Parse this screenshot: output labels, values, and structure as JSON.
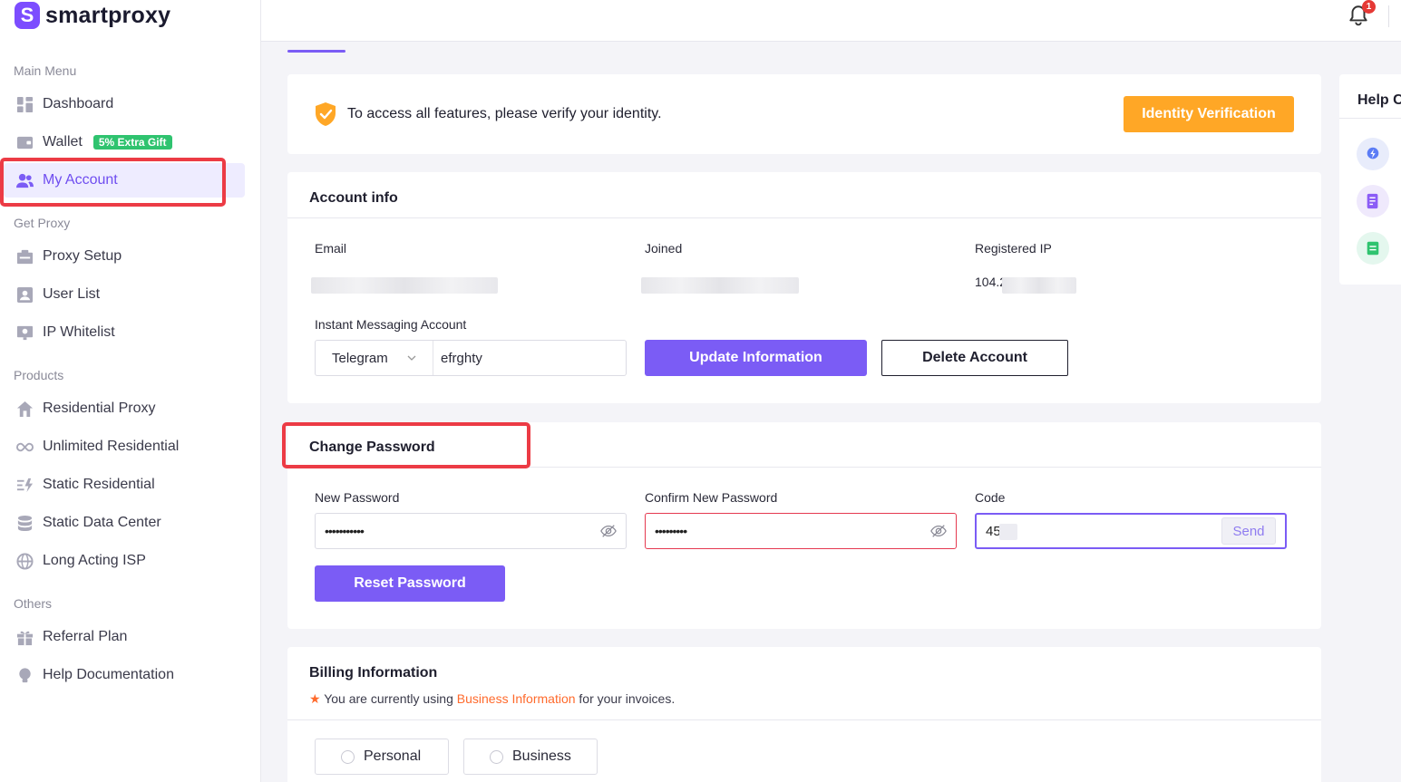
{
  "brand": {
    "name": "smartproxy"
  },
  "sidebar": {
    "sections": {
      "main": "Main Menu",
      "get_proxy": "Get Proxy",
      "products": "Products",
      "others": "Others"
    },
    "items": {
      "dashboard": "Dashboard",
      "wallet": "Wallet",
      "wallet_badge": "5% Extra Gift",
      "my_account": "My Account",
      "proxy_setup": "Proxy Setup",
      "user_list": "User List",
      "ip_whitelist": "IP Whitelist",
      "residential_proxy": "Residential Proxy",
      "unlimited_residential": "Unlimited Residential",
      "static_residential": "Static Residential",
      "static_data_center": "Static Data Center",
      "long_acting_isp": "Long Acting ISP",
      "referral_plan": "Referral Plan",
      "help_documentation": "Help Documentation"
    },
    "active": "my_account"
  },
  "topbar": {
    "notification_count": "1"
  },
  "verify": {
    "message": "To access all features, please verify your identity.",
    "button": "Identity Verification"
  },
  "account_info": {
    "title": "Account info",
    "email_label": "Email",
    "joined_label": "Joined",
    "registered_ip_label": "Registered IP",
    "registered_ip_value": "104.2‹",
    "im_label": "Instant Messaging Account",
    "im_type": "Telegram",
    "im_value": "efrghty",
    "update_button": "Update Information",
    "delete_button": "Delete Account"
  },
  "change_password": {
    "title": "Change Password",
    "new_label": "New Password",
    "new_value": "•••••••••••",
    "confirm_label": "Confirm New Password",
    "confirm_value": "•••••••••",
    "code_label": "Code",
    "code_value": "45",
    "send_button": "Send",
    "reset_button": "Reset Password"
  },
  "billing": {
    "title": "Billing Information",
    "note_prefix": "You are currently using",
    "note_link": "Business Information",
    "note_suffix": "for your invoices.",
    "options": [
      "Personal",
      "Business"
    ]
  },
  "help": {
    "title": "Help Center"
  },
  "colors": {
    "accent": "#7b5cf5",
    "orange": "#ffa726",
    "highlight": "#ec3b45",
    "success": "#2fc36f"
  }
}
